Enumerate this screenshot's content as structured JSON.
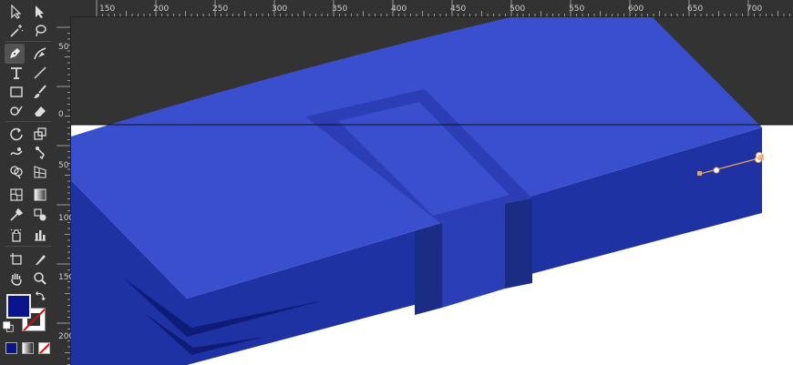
{
  "app": {
    "colors": {
      "fill_swatch": "#0a148c",
      "artboard": "#ffffff",
      "pasteboard": "#333333",
      "panel": "#323232",
      "book_top": "#3a4fce",
      "book_front": "#1e32a3",
      "book_band_top": "#2c3db6",
      "book_band_front": "#2a3eb8",
      "book_band_side": "#1a2c84",
      "anchor_orange": "#e8a060"
    }
  },
  "toolbar": {
    "tools": [
      {
        "name": "selection-tool-icon"
      },
      {
        "name": "direct-selection-tool-icon"
      },
      {
        "name": "magic-wand-tool-icon"
      },
      {
        "name": "lasso-tool-icon"
      },
      {
        "name": "pen-tool-icon"
      },
      {
        "name": "curvature-tool-icon"
      },
      {
        "name": "type-tool-icon"
      },
      {
        "name": "line-segment-tool-icon"
      },
      {
        "name": "rectangle-tool-icon"
      },
      {
        "name": "paintbrush-tool-icon"
      },
      {
        "name": "shaper-tool-icon"
      },
      {
        "name": "eraser-tool-icon"
      },
      {
        "name": "rotate-tool-icon"
      },
      {
        "name": "scale-tool-icon"
      },
      {
        "name": "warp-tool-icon"
      },
      {
        "name": "puppet-warp-tool-icon"
      },
      {
        "name": "shape-builder-tool-icon"
      },
      {
        "name": "perspective-grid-tool-icon"
      },
      {
        "name": "mesh-tool-icon"
      },
      {
        "name": "gradient-tool-icon"
      },
      {
        "name": "eyedropper-tool-icon"
      },
      {
        "name": "blend-tool-icon"
      },
      {
        "name": "symbol-sprayer-tool-icon"
      },
      {
        "name": "column-graph-tool-icon"
      },
      {
        "name": "artboard-tool-icon"
      },
      {
        "name": "slice-tool-icon"
      },
      {
        "name": "hand-tool-icon"
      },
      {
        "name": "zoom-tool-icon"
      }
    ]
  },
  "ruler": {
    "top_labels": [
      "150",
      "200",
      "250",
      "300",
      "350",
      "400",
      "450",
      "500",
      "550",
      "600",
      "650",
      "700"
    ],
    "left_labels": [
      "50",
      "0",
      "50",
      "100",
      "150",
      "200"
    ]
  }
}
